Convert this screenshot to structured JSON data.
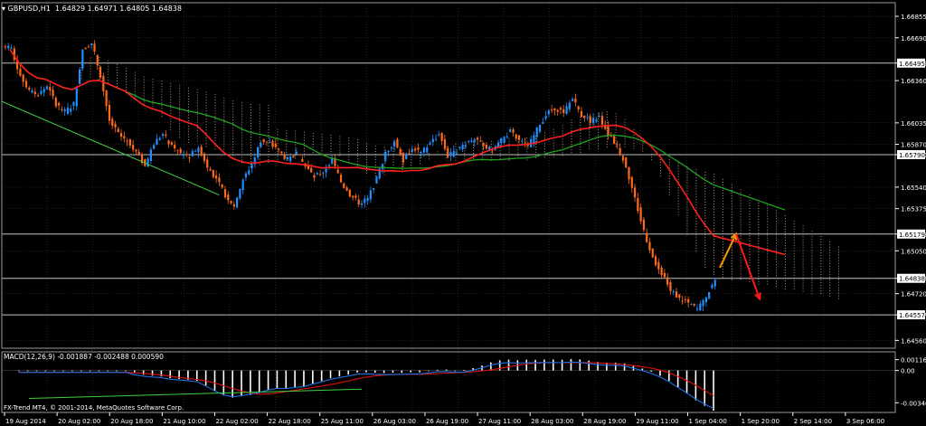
{
  "chart_data": {
    "type": "candlestick",
    "symbol_label": "GBPUSD,H1",
    "ohlc_label": "1.64829 1.64971 1.64805 1.64838",
    "price_ylim": [
      1.643,
      1.6696
    ],
    "price_ticks": [
      "1.66855",
      "1.66690",
      "1.66495",
      "1.66360",
      "1.66035",
      "1.65870",
      "1.65790",
      "1.65540",
      "1.65375",
      "1.65179",
      "1.65050",
      "1.64838",
      "1.64720",
      "1.64557",
      "1.64560"
    ],
    "price_tick_values": [
      1.66855,
      1.6669,
      1.66495,
      1.6636,
      1.66035,
      1.6587,
      1.6579,
      1.6554,
      1.65375,
      1.65179,
      1.6505,
      1.64838,
      1.6472,
      1.64557,
      1.6436
    ],
    "highlighted_levels": [
      {
        "label": "1.66495",
        "value": 1.66495
      },
      {
        "label": "1.65790",
        "value": 1.6579
      },
      {
        "label": "1.65179",
        "value": 1.65179
      },
      {
        "label": "1.64838",
        "value": 1.64838
      },
      {
        "label": "1.64557",
        "value": 1.64557
      }
    ],
    "horizontal_lines": [
      1.66495,
      1.6579,
      1.65179,
      1.64838,
      1.64557
    ],
    "x_ticks": [
      "19 Aug 2014",
      "20 Aug 02:00",
      "20 Aug 18:00",
      "21 Aug 10:00",
      "22 Aug 02:00",
      "22 Aug 18:00",
      "25 Aug 11:00",
      "26 Aug 03:00",
      "26 Aug 19:00",
      "27 Aug 11:00",
      "28 Aug 03:00",
      "28 Aug 19:00",
      "29 Aug 11:00",
      "1 Sep 04:00",
      "1 Sep 20:00",
      "2 Sep 14:00",
      "3 Sep 06:00"
    ],
    "close_path": [
      1.666,
      1.664,
      1.6628,
      1.6625,
      1.6632,
      1.6618,
      1.6612,
      1.6618,
      1.666,
      1.6665,
      1.664,
      1.6605,
      1.6595,
      1.659,
      1.6582,
      1.657,
      1.6588,
      1.6595,
      1.6585,
      1.658,
      1.6578,
      1.6585,
      1.657,
      1.656,
      1.6548,
      1.654,
      1.656,
      1.6572,
      1.659,
      1.6588,
      1.6582,
      1.6575,
      1.658,
      1.657,
      1.6562,
      1.6566,
      1.6575,
      1.6558,
      1.6548,
      1.6542,
      1.6545,
      1.656,
      1.658,
      1.659,
      1.6575,
      1.6585,
      1.658,
      1.6588,
      1.6595,
      1.6578,
      1.6582,
      1.6588,
      1.6592,
      1.6585,
      1.6583,
      1.659,
      1.6597,
      1.659,
      1.6585,
      1.6598,
      1.661,
      1.6615,
      1.6612,
      1.6622,
      1.661,
      1.6605,
      1.6608,
      1.6595,
      1.6585,
      1.657,
      1.6545,
      1.652,
      1.65,
      1.6488,
      1.6475,
      1.6468,
      1.6465,
      1.646,
      1.647,
      1.6483
    ],
    "macd_label": "MACD(12,26,9) -0.001887 -0.002488 0.000590",
    "macd_ticks": [
      "0.00116",
      "0.00",
      "-0.00346"
    ],
    "macd_ylim": [
      -0.0045,
      0.002
    ],
    "macd_tick_values": [
      0.00116,
      0.0,
      -0.00346
    ],
    "forecast_arrows": [
      {
        "color": "#ff9a00",
        "from": 1.6492,
        "to": 1.6518
      },
      {
        "color": "#ff1a1a",
        "from": 1.6518,
        "to": 1.6468
      }
    ],
    "footer_label": "FX-Trend MT4, © 2001-2014, MetaQuotes Software Corp.",
    "grid": true,
    "colors": {
      "bull": "#1e90ff",
      "bear": "#ff6a1a",
      "ma_fast": "#ff2020",
      "ma_slow": "#1fa31f",
      "trend": "#3fd03f",
      "cloud": "#e9c9b7",
      "macd_signal": "#e01010",
      "macd_main": "#1e6fe0",
      "hist": "#ffffff",
      "axis": "#ffffff",
      "grid": "#3a3a3a"
    }
  }
}
